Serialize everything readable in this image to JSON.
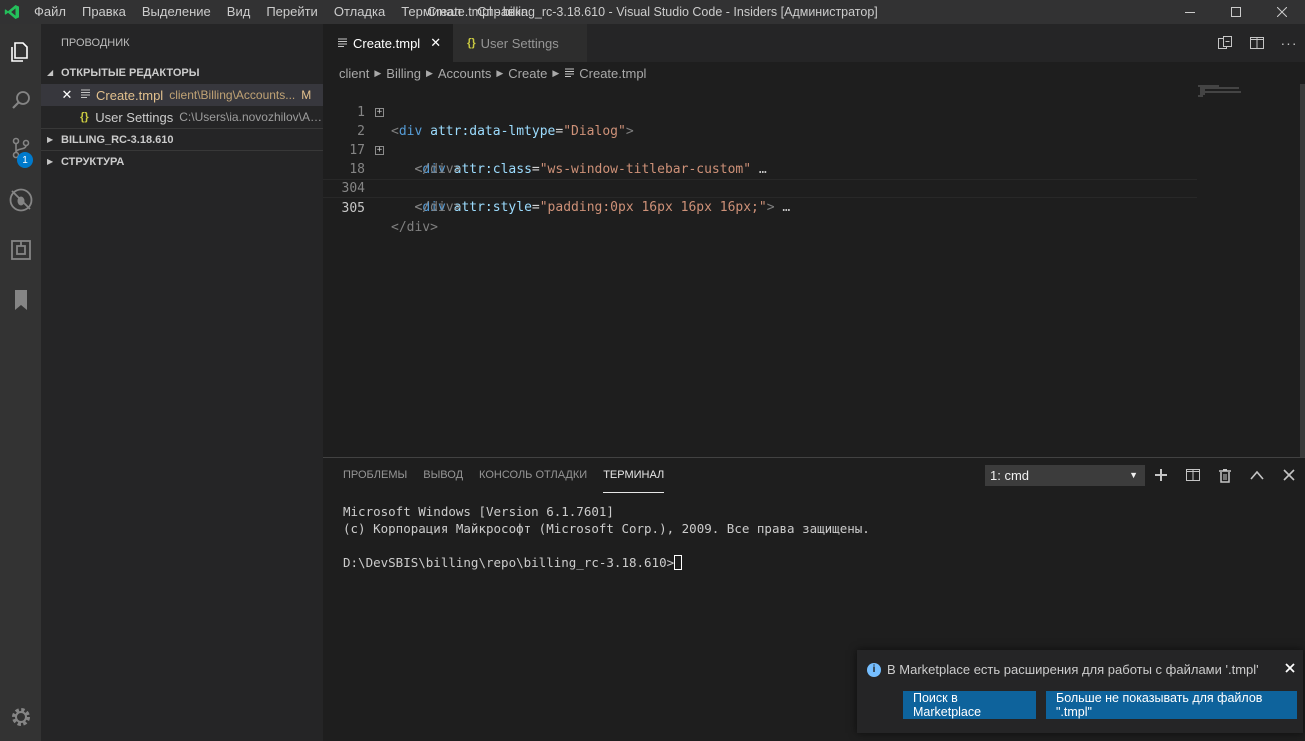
{
  "window": {
    "title": "Create.tmpl - billing_rc-3.18.610 - Visual Studio Code - Insiders [Администратор]"
  },
  "menubar": {
    "items": [
      "Файл",
      "Правка",
      "Выделение",
      "Вид",
      "Перейти",
      "Отладка",
      "Терминал",
      "Справка"
    ]
  },
  "activitybar": {
    "items": [
      "explorer-icon",
      "search-icon",
      "source-control-icon",
      "debug-icon",
      "extensions-icon",
      "bookmarks-icon"
    ],
    "scm_badge": "1",
    "settings_icon": "gear-icon"
  },
  "sidebar": {
    "title": "ПРОВОДНИК",
    "open_editors_header": "ОТКРЫТЫЕ РЕДАКТОРЫ",
    "open_editors": [
      {
        "name": "Create.tmpl",
        "path": "client\\Billing\\Accounts...",
        "modified": "M"
      },
      {
        "name": "User Settings",
        "path": "C:\\Users\\ia.novozhilov\\Ap...",
        "modified": ""
      }
    ],
    "project_header": "BILLING_RC-3.18.610",
    "outline_header": "СТРУКТУРА"
  },
  "editor": {
    "tabs": [
      {
        "label": "Create.tmpl",
        "active": true
      },
      {
        "label": "User Settings",
        "active": false
      }
    ],
    "breadcrumb": [
      "client",
      "Billing",
      "Accounts",
      "Create",
      "Create.tmpl"
    ],
    "lines": [
      {
        "num": "1",
        "folded": false,
        "indent": "",
        "tag": "div",
        "attr": "attr:data-lmtype",
        "value": "\"Dialog\"",
        "close": ">",
        "ellipsis": ""
      },
      {
        "num": "2",
        "folded": true,
        "indent": "   ",
        "tag": "div",
        "attr": "attr:class",
        "value": "\"ws-window-titlebar-custom\"",
        "close": "",
        "ellipsis": "…"
      },
      {
        "num": "17",
        "folded": false,
        "indent": "   ",
        "closing": "</div>"
      },
      {
        "num": "18",
        "folded": true,
        "indent": "   ",
        "tag": "div",
        "attr": "attr:style",
        "value": "\"padding:0px 16px 16px 16px;\"",
        "close": ">",
        "ellipsis": "…"
      },
      {
        "num": "304",
        "folded": false,
        "indent": "   ",
        "closing": "</div>"
      },
      {
        "num": "305",
        "folded": false,
        "indent": "",
        "closing": "</div>",
        "current": true
      }
    ]
  },
  "panel": {
    "tabs": [
      "ПРОБЛЕМЫ",
      "ВЫВОД",
      "КОНСОЛЬ ОТЛАДКИ",
      "ТЕРМИНАЛ"
    ],
    "active_tab": "ТЕРМИНАЛ",
    "terminal_select": "1: cmd",
    "terminal_lines": [
      "Microsoft Windows [Version 6.1.7601]",
      "(c) Корпорация Майкрософт (Microsoft Corp.), 2009. Все права защищены.",
      "",
      "D:\\DevSBIS\\billing\\repo\\billing_rc-3.18.610>"
    ]
  },
  "notification": {
    "message": "В Marketplace есть расширения для работы с файлами '.tmpl'",
    "button_search": "Поиск в Marketplace",
    "button_dismiss": "Больше не показывать для файлов \".tmpl\""
  },
  "colors": {
    "accent": "#007acc",
    "button": "#0e639c",
    "modified": "#e2c08d"
  }
}
